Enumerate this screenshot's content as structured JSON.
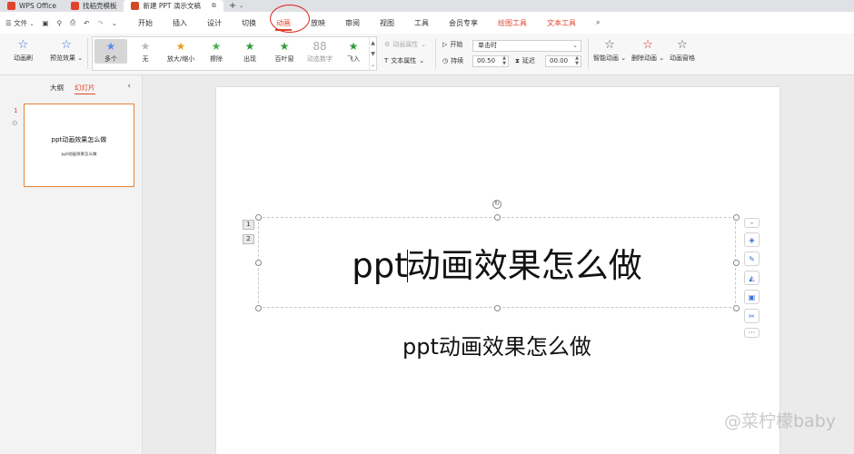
{
  "tabs": [
    {
      "label": "WPS Office",
      "logo_color": "#e0452c"
    },
    {
      "label": "找稻壳模板",
      "logo_color": "#e0452c"
    },
    {
      "label": "新建 PPT 演示文稿",
      "logo_color": "#d24726"
    }
  ],
  "menu": {
    "file": "文件",
    "items": [
      "开始",
      "插入",
      "设计",
      "切换",
      "动画",
      "放映",
      "审阅",
      "视图",
      "工具",
      "会员专享",
      "绘图工具",
      "文本工具"
    ],
    "active": "动画"
  },
  "ribbon": {
    "animation_brush": "动画刷",
    "preview": "预览效果",
    "gallery": [
      "多个",
      "无",
      "放大/缩小",
      "擦除",
      "出现",
      "百叶窗",
      "动态数字",
      "飞入"
    ],
    "anim_props": "动画属性",
    "text_props": "文本属性",
    "start_label": "开始",
    "start_value": "单击时",
    "duration_label": "持续",
    "duration_value": "00.50",
    "delay_label": "延迟",
    "delay_value": "00.00",
    "smart_anim": "智能动画",
    "delete_anim": "删除动画",
    "anim_pane": "动画窗格"
  },
  "left_pane": {
    "tab_outline": "大纲",
    "tab_slides": "幻灯片",
    "slide_number": "1",
    "thumb_title": "ppt动画效果怎么做",
    "thumb_subtitle": "ppt动画效果怎么做"
  },
  "slide": {
    "anim_tags": [
      "1",
      "2"
    ],
    "title_before_cursor": "ppt",
    "title_after_cursor": "动画效果怎么做",
    "subtitle": "ppt动画效果怎么做"
  },
  "watermark": "@菜柠檬baby",
  "colors": {
    "accent": "#e0452c",
    "annotation_circle": "#d9251b"
  }
}
